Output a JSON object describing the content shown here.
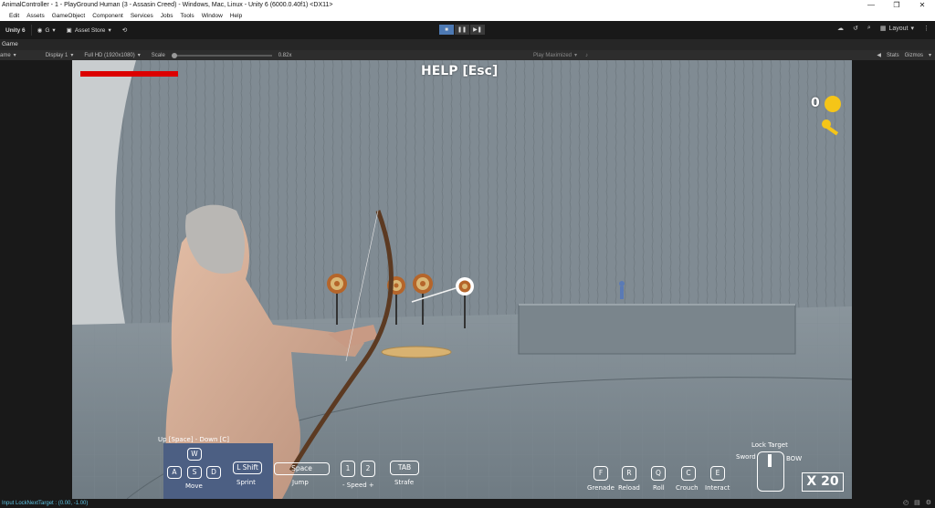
{
  "window": {
    "title": "AnimalController - 1 - PlayGround Human (3 - Assasin Creed) - Windows, Mac, Linux - Unity 6 (6000.0.40f1) <DX11>",
    "controls": [
      "—",
      "❐",
      "✕"
    ]
  },
  "menu": [
    "Edit",
    "Assets",
    "GameObject",
    "Component",
    "Services",
    "Jobs",
    "Tools",
    "Window",
    "Help"
  ],
  "toolbar": {
    "version": "Unity 6",
    "account": "G",
    "asset_store": "Asset Store",
    "layout": "Layout"
  },
  "tab": {
    "label": "Game"
  },
  "gamebar": {
    "mode": "ame",
    "display": "Display 1",
    "resolution": "Full HD (1920x1080)",
    "scale_label": "Scale",
    "scale_value": "0.82x",
    "play_mode": "Play Maximized",
    "stats": "Stats",
    "gizmos": "Gizmos"
  },
  "hud": {
    "help": "HELP [Esc]",
    "coin_count": "0",
    "health_fraction": 1.0,
    "up_down": "Up [Space] - Down [C]",
    "keys": {
      "w": "W",
      "a": "A",
      "s": "S",
      "d": "D",
      "shift": "L Shift",
      "space": "Space",
      "one": "1",
      "two": "2",
      "tab": "TAB",
      "f": "F",
      "r": "R",
      "q": "Q",
      "c": "C",
      "e": "E"
    },
    "labels": {
      "move": "Move",
      "sprint": "Sprint",
      "jump": "Jump",
      "speed": "- Speed +",
      "strafe": "Strafe",
      "grenade": "Grenade",
      "reload": "Reload",
      "roll": "Roll",
      "crouch": "Crouch",
      "interact": "Interact",
      "lock_target": "Lock Target",
      "sword": "Sword",
      "bow": "BOW"
    },
    "ammo": "X 20",
    "sign_left": "Press Mouse\nmode",
    "sign_right": "Lock Target\nChange Target"
  },
  "status": {
    "message": "Input LockNextTarget : (0.00, -1.00)"
  },
  "colors": {
    "health": "#dc0000",
    "coin": "#f5c518",
    "status_text": "#5fc1e0",
    "play_active": "#4d79b3"
  }
}
